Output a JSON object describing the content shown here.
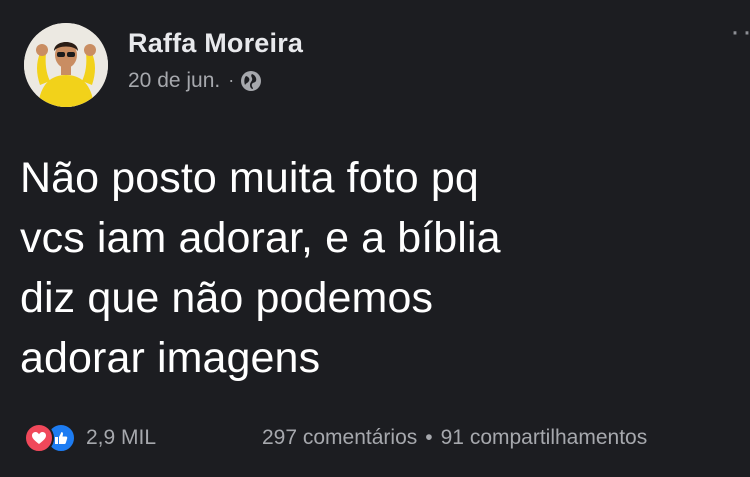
{
  "post": {
    "author": "Raffa Moreira",
    "date": "20 de jun.",
    "separator": "·",
    "privacy_icon": "globe-icon",
    "more_label": "··",
    "text": "Não posto muita foto pq\nvcs iam adorar, e a bíblia\ndiz que não podemos\nadorar imagens",
    "reactions": {
      "icons": [
        "love-icon",
        "like-icon"
      ],
      "count": "2,9 MIL"
    },
    "comments": "297 comentários",
    "stats_separator": "•",
    "shares": "91 compartilhamentos"
  },
  "colors": {
    "background": "#1c1d21",
    "text": "#ffffff",
    "secondary_text": "#a6a8ad",
    "love": "#f0485a",
    "like": "#1d7cf2"
  }
}
